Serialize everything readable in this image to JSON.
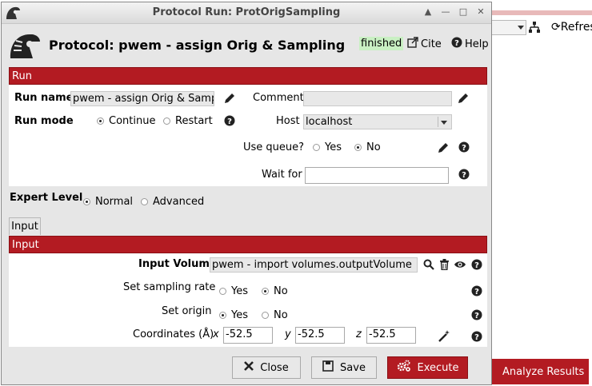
{
  "background": {
    "refresh_label": "Refres",
    "analyze_label": "Analyze Results"
  },
  "window": {
    "title": "Protocol Run: ProtOrigSampling"
  },
  "header": {
    "title": "Protocol: pwem - assign Orig & Sampling",
    "status": "finished",
    "cite_label": "Cite",
    "help_label": "Help"
  },
  "run": {
    "section_label": "Run",
    "run_name_label": "Run name",
    "run_name_value": "pwem - assign Orig & Samplin",
    "comment_label": "Comment",
    "comment_value": "",
    "run_mode_label": "Run mode",
    "run_mode_options": [
      "Continue",
      "Restart"
    ],
    "run_mode_selected": "Continue",
    "host_label": "Host",
    "host_value": "localhost",
    "use_queue_label": "Use queue?",
    "use_queue_options": [
      "Yes",
      "No"
    ],
    "use_queue_selected": "No",
    "wait_for_label": "Wait for",
    "wait_for_value": ""
  },
  "expert": {
    "label": "Expert Level",
    "options": [
      "Normal",
      "Advanced"
    ],
    "selected": "Normal"
  },
  "input": {
    "tab_label": "Input",
    "section_label": "Input",
    "input_volume_label": "Input Volume",
    "input_volume_value": "pwem - import volumes.outputVolume",
    "sampling_label": "Set sampling rate",
    "sampling_options": [
      "Yes",
      "No"
    ],
    "sampling_selected": "No",
    "origin_label": "Set origin",
    "origin_options": [
      "Yes",
      "No"
    ],
    "origin_selected": "Yes",
    "coordinates_label": "Coordinates (Å)",
    "coord_x_label": "x",
    "coord_x_value": "-52.5",
    "coord_y_label": "y",
    "coord_y_value": "-52.5",
    "coord_z_label": "z",
    "coord_z_value": "-52.5"
  },
  "footer": {
    "close_label": "Close",
    "save_label": "Save",
    "execute_label": "Execute"
  },
  "colors": {
    "accent": "#b31b22",
    "status_bg": "#c9f0c3"
  }
}
